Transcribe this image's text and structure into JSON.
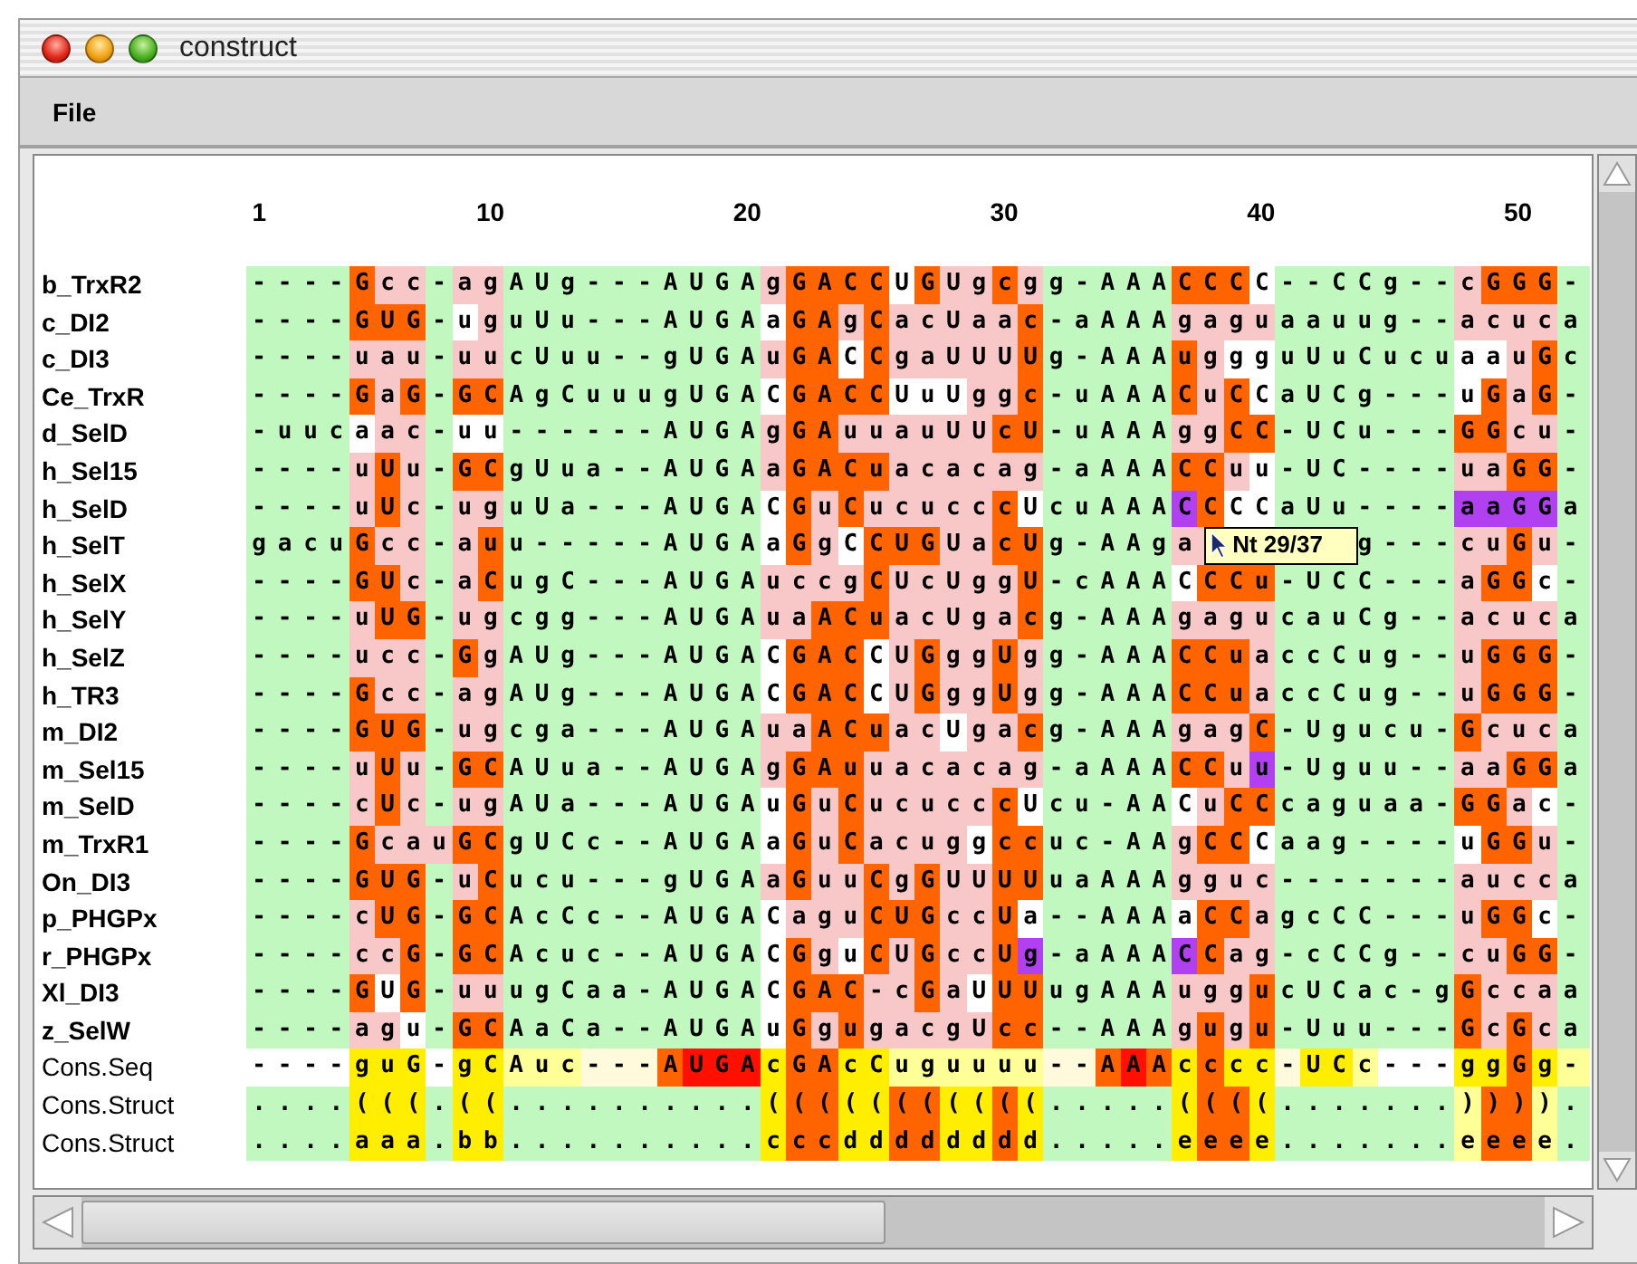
{
  "window": {
    "title": "construct"
  },
  "menu": [
    "File"
  ],
  "ruler": [
    "1",
    "10",
    "20",
    "30",
    "40",
    "50"
  ],
  "rows": [
    {
      "name": "b_TrxR2",
      "kind": "sequence",
      "runs": [
        {
          "text": "----",
          "color": "#c0f8c0"
        },
        {
          "text": "G",
          "color": "#ff6400"
        },
        {
          "text": "cc",
          "color": "#f8c8c8"
        },
        {
          "text": "-",
          "color": "#c0f8c0"
        },
        {
          "text": "ag",
          "color": "#f8c8c8"
        },
        {
          "text": "AUg---AUGA",
          "color": "#c0f8c0"
        },
        {
          "text": "g",
          "color": "#f8c8c8"
        },
        {
          "text": "GACC",
          "color": "#ff6400"
        },
        {
          "text": "U",
          "color": "#ffffff"
        },
        {
          "text": "G",
          "color": "#ff6400"
        },
        {
          "text": "Ug",
          "color": "#f8c8c8"
        },
        {
          "text": "c",
          "color": "#ff6400"
        },
        {
          "text": "g",
          "color": "#f8c8c8"
        },
        {
          "text": "g-AAA",
          "color": "#c0f8c0"
        },
        {
          "text": "CCC",
          "color": "#ff6400"
        },
        {
          "text": "C",
          "color": "#ffffff"
        },
        {
          "text": "--CCg--",
          "color": "#c0f8c0"
        },
        {
          "text": "c",
          "color": "#f8c8c8"
        },
        {
          "text": "GGG",
          "color": "#ff6400"
        },
        {
          "text": "-",
          "color": "#c0f8c0"
        }
      ]
    },
    {
      "name": "c_DI2",
      "kind": "sequence",
      "runs": [
        {
          "text": "----",
          "color": "#c0f8c0"
        },
        {
          "text": "GUG",
          "color": "#ff6400"
        },
        {
          "text": "-",
          "color": "#c0f8c0"
        },
        {
          "text": "u",
          "color": "#ffffff"
        },
        {
          "text": "g",
          "color": "#f8c8c8"
        },
        {
          "text": "uUu---AUGA",
          "color": "#c0f8c0"
        },
        {
          "text": "a",
          "color": "#ffffff"
        },
        {
          "text": "GA",
          "color": "#ff6400"
        },
        {
          "text": "g",
          "color": "#f8c8c8"
        },
        {
          "text": "C",
          "color": "#ff6400"
        },
        {
          "text": "acUaa",
          "color": "#f8c8c8"
        },
        {
          "text": "c",
          "color": "#ff6400"
        },
        {
          "text": "-aAAA",
          "color": "#c0f8c0"
        },
        {
          "text": "gagu",
          "color": "#f8c8c8"
        },
        {
          "text": "aauug--",
          "color": "#c0f8c0"
        },
        {
          "text": "acuc",
          "color": "#f8c8c8"
        },
        {
          "text": "a",
          "color": "#c0f8c0"
        }
      ]
    },
    {
      "name": "c_DI3",
      "kind": "sequence",
      "runs": [
        {
          "text": "----",
          "color": "#c0f8c0"
        },
        {
          "text": "uau",
          "color": "#f8c8c8"
        },
        {
          "text": "-",
          "color": "#c0f8c0"
        },
        {
          "text": "uu",
          "color": "#f8c8c8"
        },
        {
          "text": "cUuu--gUGA",
          "color": "#c0f8c0"
        },
        {
          "text": "u",
          "color": "#f8c8c8"
        },
        {
          "text": "GA",
          "color": "#ff6400"
        },
        {
          "text": "C",
          "color": "#ffffff"
        },
        {
          "text": "C",
          "color": "#ff6400"
        },
        {
          "text": "gaUUU",
          "color": "#f8c8c8"
        },
        {
          "text": "U",
          "color": "#ff6400"
        },
        {
          "text": "g-AAA",
          "color": "#c0f8c0"
        },
        {
          "text": "u",
          "color": "#ff6400"
        },
        {
          "text": "g",
          "color": "#f8c8c8"
        },
        {
          "text": "gg",
          "color": "#ffffff"
        },
        {
          "text": "uUuCucu",
          "color": "#c0f8c0"
        },
        {
          "text": "aa",
          "color": "#ffffff"
        },
        {
          "text": "u",
          "color": "#f8c8c8"
        },
        {
          "text": "G",
          "color": "#ff6400"
        },
        {
          "text": "c",
          "color": "#c0f8c0"
        }
      ]
    },
    {
      "name": "Ce_TrxR",
      "kind": "sequence",
      "runs": [
        {
          "text": "----",
          "color": "#c0f8c0"
        },
        {
          "text": "G",
          "color": "#ff6400"
        },
        {
          "text": "a",
          "color": "#f8c8c8"
        },
        {
          "text": "G",
          "color": "#ff6400"
        },
        {
          "text": "-",
          "color": "#c0f8c0"
        },
        {
          "text": "GC",
          "color": "#ff6400"
        },
        {
          "text": "AgCuuugUGA",
          "color": "#c0f8c0"
        },
        {
          "text": "C",
          "color": "#ffffff"
        },
        {
          "text": "GACC",
          "color": "#ff6400"
        },
        {
          "text": "UuU",
          "color": "#ffffff"
        },
        {
          "text": "gg",
          "color": "#f8c8c8"
        },
        {
          "text": "c",
          "color": "#ff6400"
        },
        {
          "text": "-uAAA",
          "color": "#c0f8c0"
        },
        {
          "text": "C",
          "color": "#ff6400"
        },
        {
          "text": "u",
          "color": "#f8c8c8"
        },
        {
          "text": "C",
          "color": "#ff6400"
        },
        {
          "text": "C",
          "color": "#ffffff"
        },
        {
          "text": "aUCg---",
          "color": "#c0f8c0"
        },
        {
          "text": "u",
          "color": "#ffffff"
        },
        {
          "text": "G",
          "color": "#ff6400"
        },
        {
          "text": "a",
          "color": "#f8c8c8"
        },
        {
          "text": "G",
          "color": "#ff6400"
        },
        {
          "text": "-",
          "color": "#c0f8c0"
        }
      ]
    },
    {
      "name": "d_SelD",
      "kind": "sequence",
      "runs": [
        {
          "text": "-uuc",
          "color": "#c0f8c0"
        },
        {
          "text": "a",
          "color": "#ffffff"
        },
        {
          "text": "ac",
          "color": "#f8c8c8"
        },
        {
          "text": "-",
          "color": "#c0f8c0"
        },
        {
          "text": "uu",
          "color": "#ffffff"
        },
        {
          "text": "------AUGA",
          "color": "#c0f8c0"
        },
        {
          "text": "g",
          "color": "#f8c8c8"
        },
        {
          "text": "GA",
          "color": "#ff6400"
        },
        {
          "text": "uuauUU",
          "color": "#f8c8c8"
        },
        {
          "text": "cU",
          "color": "#ff6400"
        },
        {
          "text": "-uAAA",
          "color": "#c0f8c0"
        },
        {
          "text": "gg",
          "color": "#f8c8c8"
        },
        {
          "text": "CC",
          "color": "#ff6400"
        },
        {
          "text": "-UCu---",
          "color": "#c0f8c0"
        },
        {
          "text": "GG",
          "color": "#ff6400"
        },
        {
          "text": "cu",
          "color": "#f8c8c8"
        },
        {
          "text": "-",
          "color": "#c0f8c0"
        }
      ]
    },
    {
      "name": "h_Sel15",
      "kind": "sequence",
      "runs": [
        {
          "text": "----",
          "color": "#c0f8c0"
        },
        {
          "text": "u",
          "color": "#f8c8c8"
        },
        {
          "text": "U",
          "color": "#ff6400"
        },
        {
          "text": "u",
          "color": "#f8c8c8"
        },
        {
          "text": "-",
          "color": "#c0f8c0"
        },
        {
          "text": "GC",
          "color": "#ff6400"
        },
        {
          "text": "gUua--AUGA",
          "color": "#c0f8c0"
        },
        {
          "text": "a",
          "color": "#f8c8c8"
        },
        {
          "text": "GACu",
          "color": "#ff6400"
        },
        {
          "text": "acacag",
          "color": "#f8c8c8"
        },
        {
          "text": "-aAAA",
          "color": "#c0f8c0"
        },
        {
          "text": "CC",
          "color": "#ff6400"
        },
        {
          "text": "u",
          "color": "#f8c8c8"
        },
        {
          "text": "u",
          "color": "#ffffff"
        },
        {
          "text": "-UC----",
          "color": "#c0f8c0"
        },
        {
          "text": "ua",
          "color": "#f8c8c8"
        },
        {
          "text": "GG",
          "color": "#ff6400"
        },
        {
          "text": "-",
          "color": "#c0f8c0"
        }
      ]
    },
    {
      "name": "h_SelD",
      "kind": "sequence",
      "runs": [
        {
          "text": "----",
          "color": "#c0f8c0"
        },
        {
          "text": "u",
          "color": "#f8c8c8"
        },
        {
          "text": "U",
          "color": "#ff6400"
        },
        {
          "text": "c",
          "color": "#f8c8c8"
        },
        {
          "text": "-",
          "color": "#c0f8c0"
        },
        {
          "text": "ug",
          "color": "#f8c8c8"
        },
        {
          "text": "uUa---AUGA",
          "color": "#c0f8c0"
        },
        {
          "text": "C",
          "color": "#ffffff"
        },
        {
          "text": "G",
          "color": "#ff6400"
        },
        {
          "text": "u",
          "color": "#f8c8c8"
        },
        {
          "text": "C",
          "color": "#ff6400"
        },
        {
          "text": "ucucc",
          "color": "#f8c8c8"
        },
        {
          "text": "c",
          "color": "#ff6400"
        },
        {
          "text": "U",
          "color": "#ffffff"
        },
        {
          "text": "cuAAA",
          "color": "#c0f8c0"
        },
        {
          "text": "C",
          "color": "#b040f0"
        },
        {
          "text": "C",
          "color": "#ff6400"
        },
        {
          "text": "CC",
          "color": "#ffffff"
        },
        {
          "text": "aUu----",
          "color": "#c0f8c0"
        },
        {
          "text": "aaGG",
          "color": "#b040f0"
        },
        {
          "text": "a",
          "color": "#c0f8c0"
        }
      ]
    },
    {
      "name": "h_SelT",
      "kind": "sequence",
      "runs": [
        {
          "text": "gacu",
          "color": "#c0f8c0"
        },
        {
          "text": "G",
          "color": "#ff6400"
        },
        {
          "text": "cc",
          "color": "#f8c8c8"
        },
        {
          "text": "-",
          "color": "#c0f8c0"
        },
        {
          "text": "a",
          "color": "#f8c8c8"
        },
        {
          "text": "u",
          "color": "#ff6400"
        },
        {
          "text": "u-----AUGA",
          "color": "#c0f8c0"
        },
        {
          "text": "a",
          "color": "#ffffff"
        },
        {
          "text": "G",
          "color": "#ff6400"
        },
        {
          "text": "g",
          "color": "#f8c8c8"
        },
        {
          "text": "C",
          "color": "#ffffff"
        },
        {
          "text": "CUG",
          "color": "#ff6400"
        },
        {
          "text": "Ua",
          "color": "#f8c8c8"
        },
        {
          "text": "cU",
          "color": "#ff6400"
        },
        {
          "text": "g-AAg",
          "color": "#c0f8c0"
        },
        {
          "text": "a",
          "color": "#f8c8c8"
        }
      ],
      "tooltip": "Nt 29/37",
      "tail_runs": [
        {
          "text": "g---",
          "color": "#c0f8c0"
        },
        {
          "text": "cu",
          "color": "#f8c8c8"
        },
        {
          "text": "G",
          "color": "#ff6400"
        },
        {
          "text": "u",
          "color": "#f8c8c8"
        },
        {
          "text": "-",
          "color": "#c0f8c0"
        }
      ]
    },
    {
      "name": "h_SelX",
      "kind": "sequence",
      "runs": [
        {
          "text": "----",
          "color": "#c0f8c0"
        },
        {
          "text": "GU",
          "color": "#ff6400"
        },
        {
          "text": "c",
          "color": "#f8c8c8"
        },
        {
          "text": "-",
          "color": "#c0f8c0"
        },
        {
          "text": "a",
          "color": "#f8c8c8"
        },
        {
          "text": "C",
          "color": "#ff6400"
        },
        {
          "text": "ugC---AUGA",
          "color": "#c0f8c0"
        },
        {
          "text": "uccg",
          "color": "#f8c8c8"
        },
        {
          "text": "C",
          "color": "#ff6400"
        },
        {
          "text": "UcUgg",
          "color": "#f8c8c8"
        },
        {
          "text": "U",
          "color": "#ff6400"
        },
        {
          "text": "-cAAA",
          "color": "#c0f8c0"
        },
        {
          "text": "C",
          "color": "#ffffff"
        },
        {
          "text": "CCu",
          "color": "#ff6400"
        },
        {
          "text": "-UCC---",
          "color": "#c0f8c0"
        },
        {
          "text": "a",
          "color": "#f8c8c8"
        },
        {
          "text": "GG",
          "color": "#ff6400"
        },
        {
          "text": "c",
          "color": "#ffffff"
        },
        {
          "text": "-",
          "color": "#c0f8c0"
        }
      ]
    },
    {
      "name": "h_SelY",
      "kind": "sequence",
      "runs": [
        {
          "text": "----",
          "color": "#c0f8c0"
        },
        {
          "text": "u",
          "color": "#f8c8c8"
        },
        {
          "text": "UG",
          "color": "#ff6400"
        },
        {
          "text": "-",
          "color": "#c0f8c0"
        },
        {
          "text": "ug",
          "color": "#f8c8c8"
        },
        {
          "text": "cgg---AUGA",
          "color": "#c0f8c0"
        },
        {
          "text": "ua",
          "color": "#f8c8c8"
        },
        {
          "text": "ACu",
          "color": "#ff6400"
        },
        {
          "text": "acUga",
          "color": "#f8c8c8"
        },
        {
          "text": "c",
          "color": "#ff6400"
        },
        {
          "text": "g-AAA",
          "color": "#c0f8c0"
        },
        {
          "text": "gagu",
          "color": "#f8c8c8"
        },
        {
          "text": "cauCg--",
          "color": "#c0f8c0"
        },
        {
          "text": "acuc",
          "color": "#f8c8c8"
        },
        {
          "text": "a",
          "color": "#c0f8c0"
        }
      ]
    },
    {
      "name": "h_SelZ",
      "kind": "sequence",
      "runs": [
        {
          "text": "----",
          "color": "#c0f8c0"
        },
        {
          "text": "ucc",
          "color": "#f8c8c8"
        },
        {
          "text": "-",
          "color": "#c0f8c0"
        },
        {
          "text": "G",
          "color": "#ff6400"
        },
        {
          "text": "g",
          "color": "#f8c8c8"
        },
        {
          "text": "AUg---AUGA",
          "color": "#c0f8c0"
        },
        {
          "text": "C",
          "color": "#ffffff"
        },
        {
          "text": "GAC",
          "color": "#ff6400"
        },
        {
          "text": "C",
          "color": "#ffffff"
        },
        {
          "text": "U",
          "color": "#f8c8c8"
        },
        {
          "text": "G",
          "color": "#ff6400"
        },
        {
          "text": "gg",
          "color": "#f8c8c8"
        },
        {
          "text": "U",
          "color": "#ff6400"
        },
        {
          "text": "g",
          "color": "#f8c8c8"
        },
        {
          "text": "g-AAA",
          "color": "#c0f8c0"
        },
        {
          "text": "CCu",
          "color": "#ff6400"
        },
        {
          "text": "a",
          "color": "#f8c8c8"
        },
        {
          "text": "ccCug--",
          "color": "#c0f8c0"
        },
        {
          "text": "u",
          "color": "#f8c8c8"
        },
        {
          "text": "GGG",
          "color": "#ff6400"
        },
        {
          "text": "-",
          "color": "#c0f8c0"
        }
      ]
    },
    {
      "name": "h_TR3",
      "kind": "sequence",
      "runs": [
        {
          "text": "----",
          "color": "#c0f8c0"
        },
        {
          "text": "G",
          "color": "#ff6400"
        },
        {
          "text": "cc",
          "color": "#f8c8c8"
        },
        {
          "text": "-",
          "color": "#c0f8c0"
        },
        {
          "text": "ag",
          "color": "#f8c8c8"
        },
        {
          "text": "AUg---AUGA",
          "color": "#c0f8c0"
        },
        {
          "text": "C",
          "color": "#ffffff"
        },
        {
          "text": "GAC",
          "color": "#ff6400"
        },
        {
          "text": "C",
          "color": "#ffffff"
        },
        {
          "text": "U",
          "color": "#f8c8c8"
        },
        {
          "text": "G",
          "color": "#ff6400"
        },
        {
          "text": "gg",
          "color": "#f8c8c8"
        },
        {
          "text": "U",
          "color": "#ff6400"
        },
        {
          "text": "g",
          "color": "#f8c8c8"
        },
        {
          "text": "g-AAA",
          "color": "#c0f8c0"
        },
        {
          "text": "CCu",
          "color": "#ff6400"
        },
        {
          "text": "a",
          "color": "#f8c8c8"
        },
        {
          "text": "ccCug--",
          "color": "#c0f8c0"
        },
        {
          "text": "u",
          "color": "#f8c8c8"
        },
        {
          "text": "GGG",
          "color": "#ff6400"
        },
        {
          "text": "-",
          "color": "#c0f8c0"
        }
      ]
    },
    {
      "name": "m_DI2",
      "kind": "sequence",
      "runs": [
        {
          "text": "----",
          "color": "#c0f8c0"
        },
        {
          "text": "GUG",
          "color": "#ff6400"
        },
        {
          "text": "-",
          "color": "#c0f8c0"
        },
        {
          "text": "ug",
          "color": "#f8c8c8"
        },
        {
          "text": "cga---AUGA",
          "color": "#c0f8c0"
        },
        {
          "text": "ua",
          "color": "#f8c8c8"
        },
        {
          "text": "ACu",
          "color": "#ff6400"
        },
        {
          "text": "ac",
          "color": "#f8c8c8"
        },
        {
          "text": "U",
          "color": "#ffffff"
        },
        {
          "text": "ga",
          "color": "#f8c8c8"
        },
        {
          "text": "c",
          "color": "#ff6400"
        },
        {
          "text": "g-AAA",
          "color": "#c0f8c0"
        },
        {
          "text": "gag",
          "color": "#f8c8c8"
        },
        {
          "text": "C",
          "color": "#ff6400"
        },
        {
          "text": "-Ugucu-",
          "color": "#c0f8c0"
        },
        {
          "text": "G",
          "color": "#ff6400"
        },
        {
          "text": "cuc",
          "color": "#f8c8c8"
        },
        {
          "text": "a",
          "color": "#c0f8c0"
        }
      ]
    },
    {
      "name": "m_Sel15",
      "kind": "sequence",
      "runs": [
        {
          "text": "----",
          "color": "#c0f8c0"
        },
        {
          "text": "u",
          "color": "#f8c8c8"
        },
        {
          "text": "U",
          "color": "#ff6400"
        },
        {
          "text": "u",
          "color": "#f8c8c8"
        },
        {
          "text": "-",
          "color": "#c0f8c0"
        },
        {
          "text": "GC",
          "color": "#ff6400"
        },
        {
          "text": "AUua--AUGA",
          "color": "#c0f8c0"
        },
        {
          "text": "g",
          "color": "#f8c8c8"
        },
        {
          "text": "GAu",
          "color": "#ff6400"
        },
        {
          "text": "uacacag",
          "color": "#f8c8c8"
        },
        {
          "text": "-aAAA",
          "color": "#c0f8c0"
        },
        {
          "text": "CC",
          "color": "#ff6400"
        },
        {
          "text": "u",
          "color": "#f8c8c8"
        },
        {
          "text": "u",
          "color": "#b040f0"
        },
        {
          "text": "-Uguu--",
          "color": "#c0f8c0"
        },
        {
          "text": "aa",
          "color": "#f8c8c8"
        },
        {
          "text": "GG",
          "color": "#ff6400"
        },
        {
          "text": "a",
          "color": "#c0f8c0"
        }
      ]
    },
    {
      "name": "m_SelD",
      "kind": "sequence",
      "runs": [
        {
          "text": "----",
          "color": "#c0f8c0"
        },
        {
          "text": "c",
          "color": "#f8c8c8"
        },
        {
          "text": "U",
          "color": "#ff6400"
        },
        {
          "text": "c",
          "color": "#f8c8c8"
        },
        {
          "text": "-",
          "color": "#c0f8c0"
        },
        {
          "text": "ug",
          "color": "#f8c8c8"
        },
        {
          "text": "AUa---AUGA",
          "color": "#c0f8c0"
        },
        {
          "text": "u",
          "color": "#ffffff"
        },
        {
          "text": "G",
          "color": "#ff6400"
        },
        {
          "text": "u",
          "color": "#f8c8c8"
        },
        {
          "text": "C",
          "color": "#ff6400"
        },
        {
          "text": "ucucc",
          "color": "#f8c8c8"
        },
        {
          "text": "c",
          "color": "#ff6400"
        },
        {
          "text": "U",
          "color": "#ffffff"
        },
        {
          "text": "cu-AA",
          "color": "#c0f8c0"
        },
        {
          "text": "C",
          "color": "#ffffff"
        },
        {
          "text": "u",
          "color": "#f8c8c8"
        },
        {
          "text": "CC",
          "color": "#ff6400"
        },
        {
          "text": "caguaa-",
          "color": "#c0f8c0"
        },
        {
          "text": "GG",
          "color": "#ff6400"
        },
        {
          "text": "a",
          "color": "#f8c8c8"
        },
        {
          "text": "c",
          "color": "#ffffff"
        },
        {
          "text": "-",
          "color": "#c0f8c0"
        }
      ]
    },
    {
      "name": "m_TrxR1",
      "kind": "sequence",
      "runs": [
        {
          "text": "----",
          "color": "#c0f8c0"
        },
        {
          "text": "G",
          "color": "#ff6400"
        },
        {
          "text": "cau",
          "color": "#f8c8c8"
        },
        {
          "text": "GC",
          "color": "#ff6400"
        },
        {
          "text": "gUCc--AUGA",
          "color": "#c0f8c0"
        },
        {
          "text": "a",
          "color": "#ffffff"
        },
        {
          "text": "G",
          "color": "#ff6400"
        },
        {
          "text": "u",
          "color": "#f8c8c8"
        },
        {
          "text": "C",
          "color": "#ff6400"
        },
        {
          "text": "acug",
          "color": "#f8c8c8"
        },
        {
          "text": "g",
          "color": "#ffffff"
        },
        {
          "text": "cc",
          "color": "#ff6400"
        },
        {
          "text": "uc-AA",
          "color": "#c0f8c0"
        },
        {
          "text": "g",
          "color": "#f8c8c8"
        },
        {
          "text": "CC",
          "color": "#ff6400"
        },
        {
          "text": "C",
          "color": "#ffffff"
        },
        {
          "text": "aag----",
          "color": "#c0f8c0"
        },
        {
          "text": "u",
          "color": "#ffffff"
        },
        {
          "text": "GG",
          "color": "#ff6400"
        },
        {
          "text": "u",
          "color": "#f8c8c8"
        },
        {
          "text": "-",
          "color": "#c0f8c0"
        }
      ]
    },
    {
      "name": "On_DI3",
      "kind": "sequence",
      "runs": [
        {
          "text": "----",
          "color": "#c0f8c0"
        },
        {
          "text": "GUG",
          "color": "#ff6400"
        },
        {
          "text": "-",
          "color": "#c0f8c0"
        },
        {
          "text": "u",
          "color": "#f8c8c8"
        },
        {
          "text": "C",
          "color": "#ff6400"
        },
        {
          "text": "ucu---gUGA",
          "color": "#c0f8c0"
        },
        {
          "text": "a",
          "color": "#f8c8c8"
        },
        {
          "text": "G",
          "color": "#ff6400"
        },
        {
          "text": "uu",
          "color": "#f8c8c8"
        },
        {
          "text": "C",
          "color": "#ff6400"
        },
        {
          "text": "g",
          "color": "#f8c8c8"
        },
        {
          "text": "G",
          "color": "#ff6400"
        },
        {
          "text": "UU",
          "color": "#f8c8c8"
        },
        {
          "text": "UU",
          "color": "#ff6400"
        },
        {
          "text": "uaAAA",
          "color": "#c0f8c0"
        },
        {
          "text": "gguc",
          "color": "#f8c8c8"
        },
        {
          "text": "-------",
          "color": "#c0f8c0"
        },
        {
          "text": "aucc",
          "color": "#f8c8c8"
        },
        {
          "text": "a",
          "color": "#c0f8c0"
        }
      ]
    },
    {
      "name": "p_PHGPx",
      "kind": "sequence",
      "runs": [
        {
          "text": "----",
          "color": "#c0f8c0"
        },
        {
          "text": "c",
          "color": "#f8c8c8"
        },
        {
          "text": "UG",
          "color": "#ff6400"
        },
        {
          "text": "-",
          "color": "#c0f8c0"
        },
        {
          "text": "GC",
          "color": "#ff6400"
        },
        {
          "text": "AcCc--AUGA",
          "color": "#c0f8c0"
        },
        {
          "text": "C",
          "color": "#ffffff"
        },
        {
          "text": "agu",
          "color": "#f8c8c8"
        },
        {
          "text": "CUG",
          "color": "#ff6400"
        },
        {
          "text": "cc",
          "color": "#f8c8c8"
        },
        {
          "text": "U",
          "color": "#ff6400"
        },
        {
          "text": "a",
          "color": "#ffffff"
        },
        {
          "text": "--AAA",
          "color": "#c0f8c0"
        },
        {
          "text": "a",
          "color": "#ffffff"
        },
        {
          "text": "CC",
          "color": "#ff6400"
        },
        {
          "text": "a",
          "color": "#f8c8c8"
        },
        {
          "text": "gcCC---",
          "color": "#c0f8c0"
        },
        {
          "text": "u",
          "color": "#f8c8c8"
        },
        {
          "text": "GG",
          "color": "#ff6400"
        },
        {
          "text": "c",
          "color": "#ffffff"
        },
        {
          "text": "-",
          "color": "#c0f8c0"
        }
      ]
    },
    {
      "name": "r_PHGPx",
      "kind": "sequence",
      "runs": [
        {
          "text": "----",
          "color": "#c0f8c0"
        },
        {
          "text": "cc",
          "color": "#f8c8c8"
        },
        {
          "text": "G",
          "color": "#ff6400"
        },
        {
          "text": "-",
          "color": "#c0f8c0"
        },
        {
          "text": "GC",
          "color": "#ff6400"
        },
        {
          "text": "Acuc--AUGA",
          "color": "#c0f8c0"
        },
        {
          "text": "C",
          "color": "#ffffff"
        },
        {
          "text": "G",
          "color": "#ff6400"
        },
        {
          "text": "g",
          "color": "#f8c8c8"
        },
        {
          "text": "u",
          "color": "#ffffff"
        },
        {
          "text": "C",
          "color": "#ff6400"
        },
        {
          "text": "U",
          "color": "#f8c8c8"
        },
        {
          "text": "G",
          "color": "#ff6400"
        },
        {
          "text": "cc",
          "color": "#f8c8c8"
        },
        {
          "text": "U",
          "color": "#ff6400"
        },
        {
          "text": "g",
          "color": "#b040f0"
        },
        {
          "text": "-aAAA",
          "color": "#c0f8c0"
        },
        {
          "text": "C",
          "color": "#b040f0"
        },
        {
          "text": "C",
          "color": "#ff6400"
        },
        {
          "text": "ag",
          "color": "#f8c8c8"
        },
        {
          "text": "-cCCg--",
          "color": "#c0f8c0"
        },
        {
          "text": "cu",
          "color": "#f8c8c8"
        },
        {
          "text": "GG",
          "color": "#ff6400"
        },
        {
          "text": "-",
          "color": "#c0f8c0"
        }
      ]
    },
    {
      "name": "Xl_DI3",
      "kind": "sequence",
      "runs": [
        {
          "text": "----",
          "color": "#c0f8c0"
        },
        {
          "text": "G",
          "color": "#ff6400"
        },
        {
          "text": "U",
          "color": "#ffffff"
        },
        {
          "text": "G",
          "color": "#ff6400"
        },
        {
          "text": "-",
          "color": "#c0f8c0"
        },
        {
          "text": "uu",
          "color": "#f8c8c8"
        },
        {
          "text": "ugCaa-AUGA",
          "color": "#c0f8c0"
        },
        {
          "text": "C",
          "color": "#ffffff"
        },
        {
          "text": "GAC",
          "color": "#ff6400"
        },
        {
          "text": "-c",
          "color": "#f8c8c8"
        },
        {
          "text": "G",
          "color": "#ff6400"
        },
        {
          "text": "a",
          "color": "#f8c8c8"
        },
        {
          "text": "U",
          "color": "#ffffff"
        },
        {
          "text": "UU",
          "color": "#ff6400"
        },
        {
          "text": "ugAAA",
          "color": "#c0f8c0"
        },
        {
          "text": "ugg",
          "color": "#f8c8c8"
        },
        {
          "text": "u",
          "color": "#ff6400"
        },
        {
          "text": "cUCac-g",
          "color": "#c0f8c0"
        },
        {
          "text": "G",
          "color": "#ff6400"
        },
        {
          "text": "cca",
          "color": "#f8c8c8"
        },
        {
          "text": "a",
          "color": "#c0f8c0"
        }
      ]
    },
    {
      "name": "z_SelW",
      "kind": "sequence",
      "runs": [
        {
          "text": "----",
          "color": "#c0f8c0"
        },
        {
          "text": "ag",
          "color": "#f8c8c8"
        },
        {
          "text": "u",
          "color": "#ffffff"
        },
        {
          "text": "-",
          "color": "#c0f8c0"
        },
        {
          "text": "GC",
          "color": "#ff6400"
        },
        {
          "text": "AaCa--AUGA",
          "color": "#c0f8c0"
        },
        {
          "text": "u",
          "color": "#ffffff"
        },
        {
          "text": "G",
          "color": "#ff6400"
        },
        {
          "text": "g",
          "color": "#f8c8c8"
        },
        {
          "text": "u",
          "color": "#ff6400"
        },
        {
          "text": "gacgU",
          "color": "#f8c8c8"
        },
        {
          "text": "cc",
          "color": "#ff6400"
        },
        {
          "text": "--AAA",
          "color": "#c0f8c0"
        },
        {
          "text": "g",
          "color": "#f8c8c8"
        },
        {
          "text": "u",
          "color": "#ff6400"
        },
        {
          "text": "g",
          "color": "#f8c8c8"
        },
        {
          "text": "u",
          "color": "#ff6400"
        },
        {
          "text": "-Uuu---",
          "color": "#c0f8c0"
        },
        {
          "text": "G",
          "color": "#ff6400"
        },
        {
          "text": "c",
          "color": "#f8c8c8"
        },
        {
          "text": "G",
          "color": "#ff6400"
        },
        {
          "text": "c",
          "color": "#f8c8c8"
        },
        {
          "text": "a",
          "color": "#c0f8c0"
        }
      ]
    },
    {
      "name": "Cons.Seq",
      "kind": "consensus",
      "runs": [
        {
          "text": "----",
          "color": "#ffffff"
        },
        {
          "text": "guG",
          "color": "#ffee00"
        },
        {
          "text": "-",
          "color": "#ffffff"
        },
        {
          "text": "gC",
          "color": "#ffee00"
        },
        {
          "text": "Auc",
          "color": "#ffff98"
        },
        {
          "text": "---",
          "color": "#fffadc"
        },
        {
          "text": "A",
          "color": "#ff6400"
        },
        {
          "text": "UGA",
          "color": "#ff1000"
        },
        {
          "text": "c",
          "color": "#ffee00"
        },
        {
          "text": "GA",
          "color": "#ff6400"
        },
        {
          "text": "cC",
          "color": "#ffee00"
        },
        {
          "text": "uguuuu",
          "color": "#ffff98"
        },
        {
          "text": "--",
          "color": "#fffadc"
        },
        {
          "text": "A",
          "color": "#ff6400"
        },
        {
          "text": "A",
          "color": "#ff1000"
        },
        {
          "text": "A",
          "color": "#ff6400"
        },
        {
          "text": "c",
          "color": "#ffee00"
        },
        {
          "text": "c",
          "color": "#ff6400"
        },
        {
          "text": "cc",
          "color": "#ffee00"
        },
        {
          "text": "-",
          "color": "#fffadc"
        },
        {
          "text": "UC",
          "color": "#ffee00"
        },
        {
          "text": "c",
          "color": "#ffff98"
        },
        {
          "text": "---",
          "color": "#ffffff"
        },
        {
          "text": "gg",
          "color": "#ffee00"
        },
        {
          "text": "G",
          "color": "#ff6400"
        },
        {
          "text": "g",
          "color": "#ffee00"
        },
        {
          "text": "-",
          "color": "#ffff98"
        }
      ]
    },
    {
      "name": "Cons.Struct",
      "kind": "structure",
      "runs": [
        {
          "text": "....",
          "color": "#c0f8c0"
        },
        {
          "text": "(((",
          "color": "#ffee00"
        },
        {
          "text": ".",
          "color": "#c0f8c0"
        },
        {
          "text": "((",
          "color": "#ffee00"
        },
        {
          "text": "..........",
          "color": "#c0f8c0"
        },
        {
          "text": "(",
          "color": "#ffee00"
        },
        {
          "text": "((",
          "color": "#ff6400"
        },
        {
          "text": "((",
          "color": "#ffee00"
        },
        {
          "text": "((",
          "color": "#ff6400"
        },
        {
          "text": "((",
          "color": "#ffee00"
        },
        {
          "text": "(",
          "color": "#ff6400"
        },
        {
          "text": "(",
          "color": "#ffee00"
        },
        {
          "text": ".....",
          "color": "#c0f8c0"
        },
        {
          "text": "(",
          "color": "#ffee00"
        },
        {
          "text": "((",
          "color": "#ff6400"
        },
        {
          "text": "(",
          "color": "#ffee00"
        },
        {
          "text": ".......",
          "color": "#c0f8c0"
        },
        {
          "text": ")",
          "color": "#ffff98"
        },
        {
          "text": "))",
          "color": "#ff6400"
        },
        {
          "text": ")",
          "color": "#ffff98"
        },
        {
          "text": ".",
          "color": "#c0f8c0"
        }
      ]
    },
    {
      "name": "Cons.Struct",
      "kind": "structure",
      "runs": [
        {
          "text": "....",
          "color": "#c0f8c0"
        },
        {
          "text": "aaa",
          "color": "#ffee00"
        },
        {
          "text": ".",
          "color": "#c0f8c0"
        },
        {
          "text": "bb",
          "color": "#ffee00"
        },
        {
          "text": "..........",
          "color": "#c0f8c0"
        },
        {
          "text": "c",
          "color": "#ffee00"
        },
        {
          "text": "cc",
          "color": "#ff6400"
        },
        {
          "text": "dd",
          "color": "#ffee00"
        },
        {
          "text": "dd",
          "color": "#ff6400"
        },
        {
          "text": "dd",
          "color": "#ffee00"
        },
        {
          "text": "d",
          "color": "#ff6400"
        },
        {
          "text": "d",
          "color": "#ffee00"
        },
        {
          "text": ".....",
          "color": "#c0f8c0"
        },
        {
          "text": "e",
          "color": "#ffee00"
        },
        {
          "text": "ee",
          "color": "#ff6400"
        },
        {
          "text": "e",
          "color": "#ffee00"
        },
        {
          "text": ".......",
          "color": "#c0f8c0"
        },
        {
          "text": "e",
          "color": "#ffff98"
        },
        {
          "text": "ee",
          "color": "#ff6400"
        },
        {
          "text": "e",
          "color": "#ffff98"
        },
        {
          "text": ".",
          "color": "#c0f8c0"
        }
      ]
    }
  ]
}
